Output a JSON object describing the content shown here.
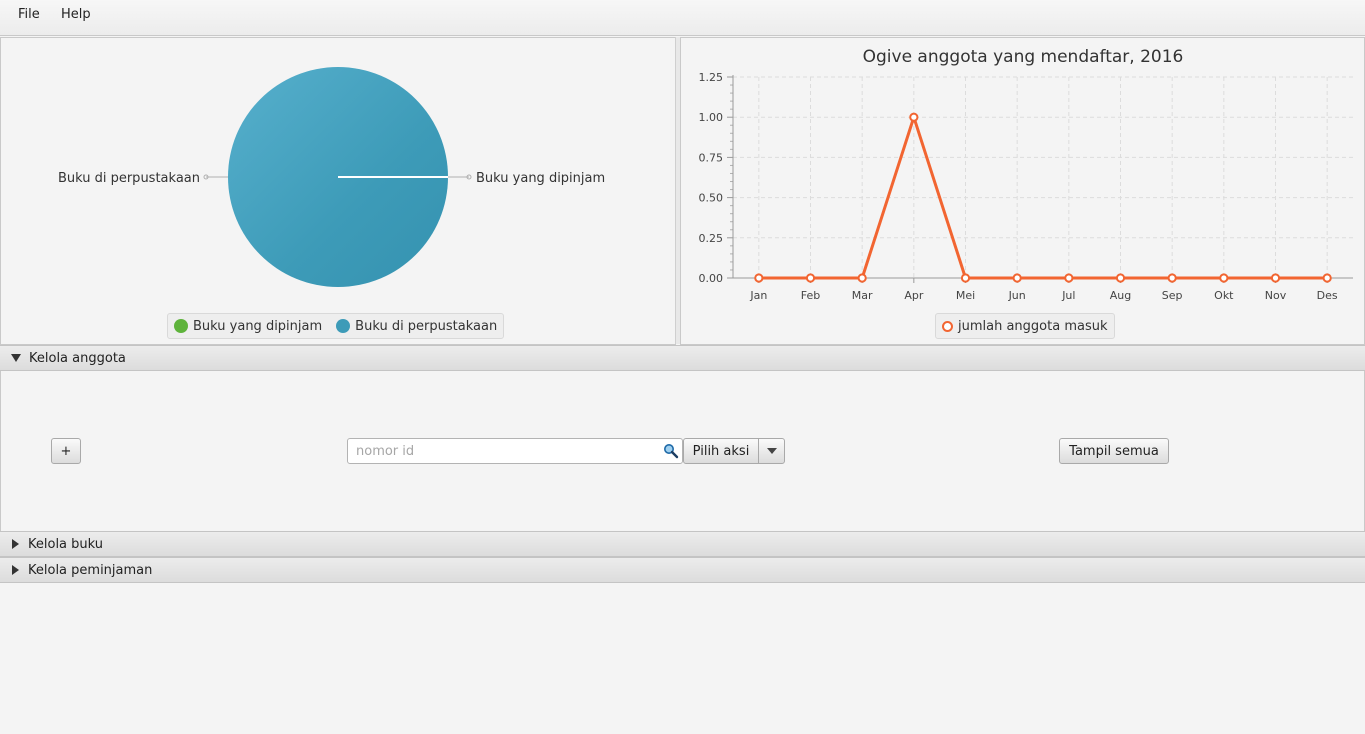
{
  "menu": {
    "file": "File",
    "help": "Help"
  },
  "pie_chart": {
    "chart_data": {
      "type": "pie",
      "slices": [
        {
          "name": "Buku yang dipinjam",
          "value": 0,
          "color": "#5eb33b"
        },
        {
          "name": "Buku di perpustakaan",
          "value": 100,
          "color": "#3d9bb8"
        }
      ]
    },
    "label_left": "Buku di perpustakaan",
    "label_right": "Buku yang dipinjam",
    "legend": [
      {
        "label": "Buku yang dipinjam",
        "color": "#5eb33b"
      },
      {
        "label": "Buku di perpustakaan",
        "color": "#3d9bb8"
      }
    ]
  },
  "chart_data": {
    "type": "line",
    "title": "Ogive anggota yang mendaftar, 2016",
    "categories": [
      "Jan",
      "Feb",
      "Mar",
      "Apr",
      "Mei",
      "Jun",
      "Jul",
      "Aug",
      "Sep",
      "Okt",
      "Nov",
      "Des"
    ],
    "series": [
      {
        "name": "jumlah anggota masuk",
        "values": [
          0,
          0,
          0,
          1,
          0,
          0,
          0,
          0,
          0,
          0,
          0,
          0
        ],
        "color": "#f26531"
      }
    ],
    "ylim": [
      0,
      1.25
    ],
    "yticks": [
      "0.00",
      "0.25",
      "0.50",
      "0.75",
      "1.00",
      "1.25"
    ],
    "grid": true,
    "legend_position": "bottom"
  },
  "panes": {
    "anggota": {
      "title": "Kelola anggota",
      "expanded": true
    },
    "buku": {
      "title": "Kelola buku",
      "expanded": false
    },
    "peminjaman": {
      "title": "Kelola peminjaman",
      "expanded": false
    }
  },
  "anggota_controls": {
    "add_label": "+",
    "search_placeholder": "nomor id",
    "search_value": "",
    "action_label": "Pilih aksi",
    "show_all_label": "Tampil semua"
  }
}
